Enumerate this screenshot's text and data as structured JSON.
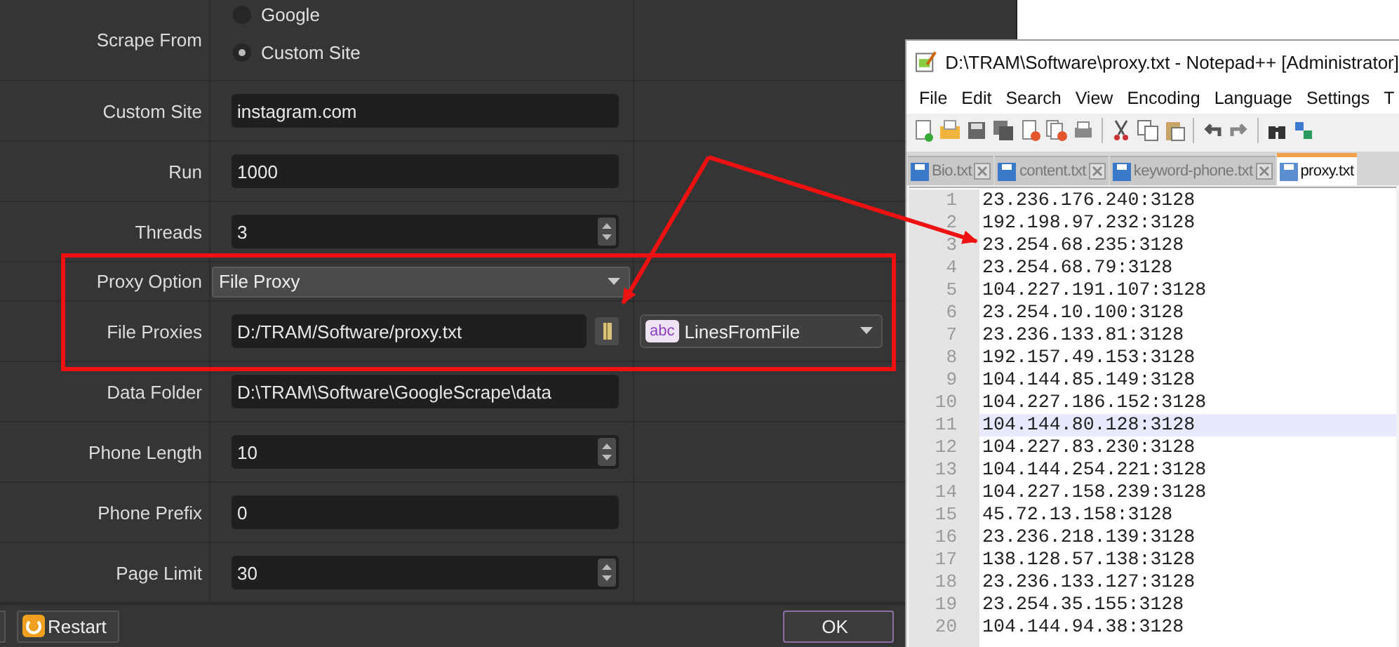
{
  "settings": {
    "rows": [
      {
        "kind": "radio",
        "label": "Scrape From",
        "options": [
          {
            "label": "Google",
            "selected": false
          },
          {
            "label": "Custom Site",
            "selected": true
          }
        ]
      },
      {
        "kind": "text",
        "label": "Custom Site",
        "value": "instagram.com"
      },
      {
        "kind": "text",
        "label": "Run",
        "value": "1000"
      },
      {
        "kind": "spin",
        "label": "Threads",
        "value": "3"
      },
      {
        "kind": "select",
        "label": "Proxy Option",
        "value": "File Proxy"
      },
      {
        "kind": "file",
        "label": "File Proxies",
        "value": "D:/TRAM/Software/proxy.txt",
        "mode_badge": "abc",
        "mode": "LinesFromFile"
      },
      {
        "kind": "text",
        "label": "Data Folder",
        "value": "D:\\TRAM\\Software\\GoogleScrape\\data"
      },
      {
        "kind": "spin",
        "label": "Phone Length",
        "value": "10"
      },
      {
        "kind": "text",
        "label": "Phone Prefix",
        "value": "0"
      },
      {
        "kind": "spin",
        "label": "Page Limit",
        "value": "30"
      }
    ]
  },
  "buttons": [
    {
      "label": "Restart"
    },
    {
      "label": "OK"
    }
  ],
  "notepad": {
    "title": "D:\\TRAM\\Software\\proxy.txt - Notepad++ [Administrator]",
    "menu": [
      "File",
      "Edit",
      "Search",
      "View",
      "Encoding",
      "Language",
      "Settings",
      "T"
    ],
    "tabs": [
      {
        "label": "Bio.txt",
        "selected": false
      },
      {
        "label": "content.txt",
        "selected": false
      },
      {
        "label": "keyword-phone.txt",
        "selected": false
      },
      {
        "label": "proxy.txt",
        "selected": true
      }
    ],
    "lines": [
      {
        "number": "1",
        "text": "23.236.176.240:3128",
        "current": false
      },
      {
        "number": "2",
        "text": "192.198.97.232:3128",
        "current": false
      },
      {
        "number": "3",
        "text": "23.254.68.235:3128",
        "current": false
      },
      {
        "number": "4",
        "text": "23.254.68.79:3128",
        "current": false
      },
      {
        "number": "5",
        "text": "104.227.191.107:3128",
        "current": false
      },
      {
        "number": "6",
        "text": "23.254.10.100:3128",
        "current": false
      },
      {
        "number": "7",
        "text": "23.236.133.81:3128",
        "current": false
      },
      {
        "number": "8",
        "text": "192.157.49.153:3128",
        "current": false
      },
      {
        "number": "9",
        "text": "104.144.85.149:3128",
        "current": false
      },
      {
        "number": "10",
        "text": "104.227.186.152:3128",
        "current": false
      },
      {
        "number": "11",
        "text": "104.144.80.128:3128",
        "current": true
      },
      {
        "number": "12",
        "text": "104.227.83.230:3128",
        "current": false
      },
      {
        "number": "13",
        "text": "104.144.254.221:3128",
        "current": false
      },
      {
        "number": "14",
        "text": "104.227.158.239:3128",
        "current": false
      },
      {
        "number": "15",
        "text": "45.72.13.158:3128",
        "current": false
      },
      {
        "number": "16",
        "text": "23.236.218.139:3128",
        "current": false
      },
      {
        "number": "17",
        "text": "138.128.57.138:3128",
        "current": false
      },
      {
        "number": "18",
        "text": "23.236.133.127:3128",
        "current": false
      },
      {
        "number": "19",
        "text": "23.254.35.155:3128",
        "current": false
      },
      {
        "number": "20",
        "text": "104.144.94.38:3128",
        "current": false
      }
    ]
  }
}
